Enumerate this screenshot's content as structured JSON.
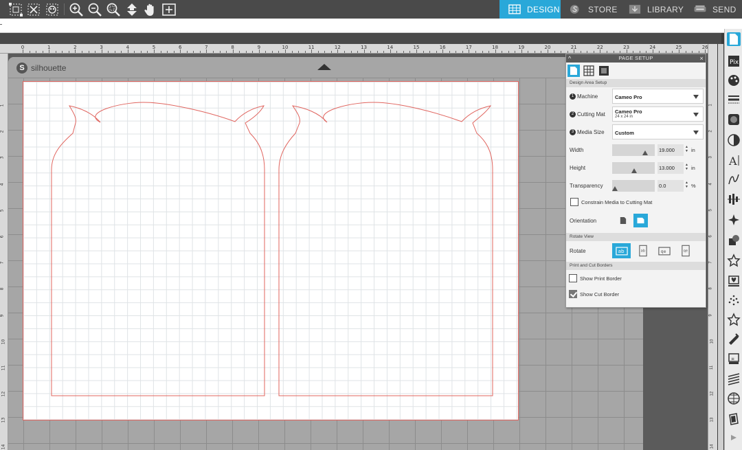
{
  "toolbar": {
    "icons": [
      "select-all-icon",
      "deselect-icon",
      "select-by-color-icon",
      "zoom-in-icon",
      "zoom-out-icon",
      "zoom-selected-icon",
      "pan-down-icon",
      "pan-hand-icon",
      "fit-to-page-icon"
    ]
  },
  "nav": {
    "design_label": "DESIGN",
    "store_label": "STORE",
    "library_label": "LIBRARY",
    "send_label": "SEND"
  },
  "ruler": {
    "top": [
      "0",
      "1",
      "2",
      "3",
      "4",
      "5",
      "6",
      "7",
      "8",
      "9",
      "10",
      "11",
      "12",
      "13",
      "14",
      "15",
      "16",
      "17",
      "18",
      "19",
      "20",
      "21",
      "22",
      "23",
      "24",
      "25",
      "26"
    ],
    "left": [
      "1",
      "2",
      "3",
      "4",
      "5",
      "6",
      "7",
      "8",
      "9",
      "10",
      "11",
      "12",
      "13",
      "14"
    ],
    "right": [
      "1",
      "2",
      "3",
      "4",
      "5",
      "6",
      "7",
      "8",
      "9",
      "10",
      "11",
      "12",
      "13",
      "14"
    ]
  },
  "mat": {
    "brand": "silhouette",
    "brand_mark": "S"
  },
  "page_setup": {
    "title": "PAGE SETUP",
    "collapse_glyph": "^",
    "close_glyph": "×",
    "design_area_section": "Design Area Setup",
    "machine_step": "1",
    "machine_label": "Machine",
    "machine_value": "Cameo Pro",
    "cutting_mat_step": "2",
    "cutting_mat_label": "Cutting Mat",
    "cutting_mat_value": "Cameo Pro",
    "cutting_mat_sub": "24 x 24 in",
    "media_size_step": "3",
    "media_size_label": "Media Size",
    "media_size_value": "Custom",
    "width_label": "Width",
    "width_value": "19.000",
    "width_unit": "in",
    "height_label": "Height",
    "height_value": "13.000",
    "height_unit": "in",
    "transparency_label": "Transparency",
    "transparency_value": "0.0",
    "transparency_unit": "%",
    "constrain_label": "Constrain Media to Cutting Mat",
    "constrain_checked": false,
    "orientation_label": "Orientation",
    "rotate_view_section": "Rotate View",
    "rotate_label": "Rotate",
    "print_cut_section": "Print and Cut Borders",
    "show_print_border_label": "Show Print Border",
    "show_print_border_checked": false,
    "show_cut_border_label": "Show Cut Border",
    "show_cut_border_checked": true
  },
  "right_panel": {
    "icons": [
      "page-setup-icon",
      "pixscan-icon",
      "fill-color-icon",
      "line-style-icon",
      "fill-pattern-icon",
      "gradient-icon",
      "text-style-icon",
      "sketch-icon",
      "align-icon",
      "replicate-icon",
      "modify-icon",
      "transform-icon",
      "design-store-icon",
      "offset-icon",
      "trace-icon",
      "knife-icon",
      "puzzle-icon",
      "layers-icon",
      "library-icon",
      "rhinestone-icon",
      "3d-icon"
    ]
  },
  "colors": {
    "accent": "#29a8d9",
    "cut_line": "#e0645e",
    "mat_gray": "#a6a6a6"
  }
}
